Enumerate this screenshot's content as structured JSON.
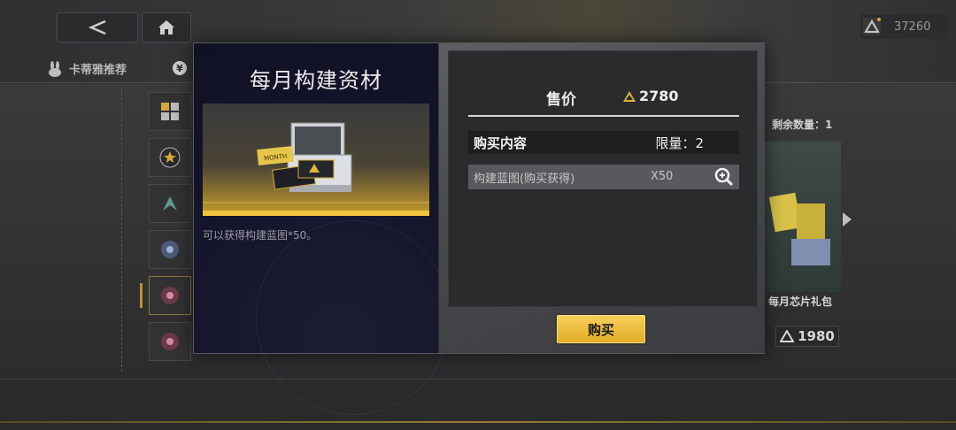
{
  "topbar": {
    "currency_value": "37260"
  },
  "tabs": [
    {
      "label": "卡蒂雅推荐"
    }
  ],
  "right_card": {
    "remaining_label": "剩余数量：1",
    "name": "每月芯片礼包",
    "price": "1980"
  },
  "modal": {
    "title": "每月构建资材",
    "item_description": "可以获得构建蓝图*50。",
    "price_label": "售价",
    "price_value": "2780",
    "contents_label": "购买内容",
    "limit_label": "限量：2",
    "contents": [
      {
        "name": "构建蓝图(购买获得)",
        "qty": "X50"
      }
    ],
    "buy_label": "购买"
  },
  "colors": {
    "accent_gold": "#f2c640",
    "button_gold": "#e3ac25",
    "modal_left_bg": "#14152a",
    "modal_right_bg": "#47484b"
  },
  "icons": [
    "back-arrow-icon",
    "home-icon",
    "currency-triangle-icon",
    "zoom-in-icon",
    "yen-icon",
    "bunny-icon"
  ]
}
